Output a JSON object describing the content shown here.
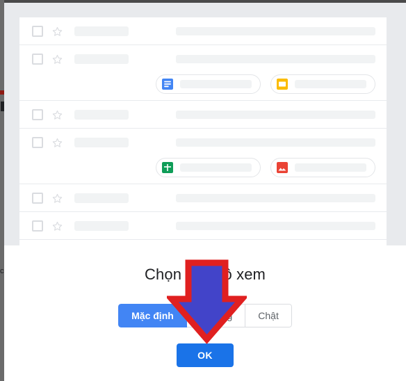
{
  "dialog": {
    "title": "Chọn chế độ xem",
    "view_options": [
      {
        "label": "Mặc định",
        "selected": true
      },
      {
        "label": "Thoáng",
        "selected": false
      },
      {
        "label": "Chật",
        "selected": false
      }
    ],
    "confirm_label": "OK"
  },
  "behind": {
    "glyph": "c"
  },
  "preview": {
    "rows": [
      {
        "checkbox_icon": "checkbox-unchecked-icon",
        "star_icon": "star-outline-icon",
        "has_chips": false
      },
      {
        "checkbox_icon": "checkbox-unchecked-icon",
        "star_icon": "star-outline-icon",
        "has_chips": true,
        "chips": [
          {
            "icon": "google-docs-icon",
            "color": "#4285f4"
          },
          {
            "icon": "google-slides-icon",
            "color": "#fbbc04"
          }
        ]
      },
      {
        "checkbox_icon": "checkbox-unchecked-icon",
        "star_icon": "star-outline-icon",
        "has_chips": false
      },
      {
        "checkbox_icon": "checkbox-unchecked-icon",
        "star_icon": "star-outline-icon",
        "has_chips": true,
        "chips": [
          {
            "icon": "google-sheets-icon",
            "color": "#0f9d58"
          },
          {
            "icon": "image-attachment-icon",
            "color": "#ea4335"
          }
        ]
      },
      {
        "checkbox_icon": "checkbox-unchecked-icon",
        "star_icon": "star-outline-icon",
        "has_chips": false
      },
      {
        "checkbox_icon": "checkbox-unchecked-icon",
        "star_icon": "star-outline-icon",
        "has_chips": false
      }
    ]
  },
  "annotation": {
    "arrow_icon": "down-arrow-annotation-icon",
    "fill_color": "#4244c9",
    "stroke_color": "#e02020"
  },
  "colors": {
    "accent_blue": "#1a73e8",
    "selected_blue": "#4285f4",
    "panel_gray": "#e8eaed",
    "text_primary": "#202124",
    "text_secondary": "#5f6368"
  }
}
